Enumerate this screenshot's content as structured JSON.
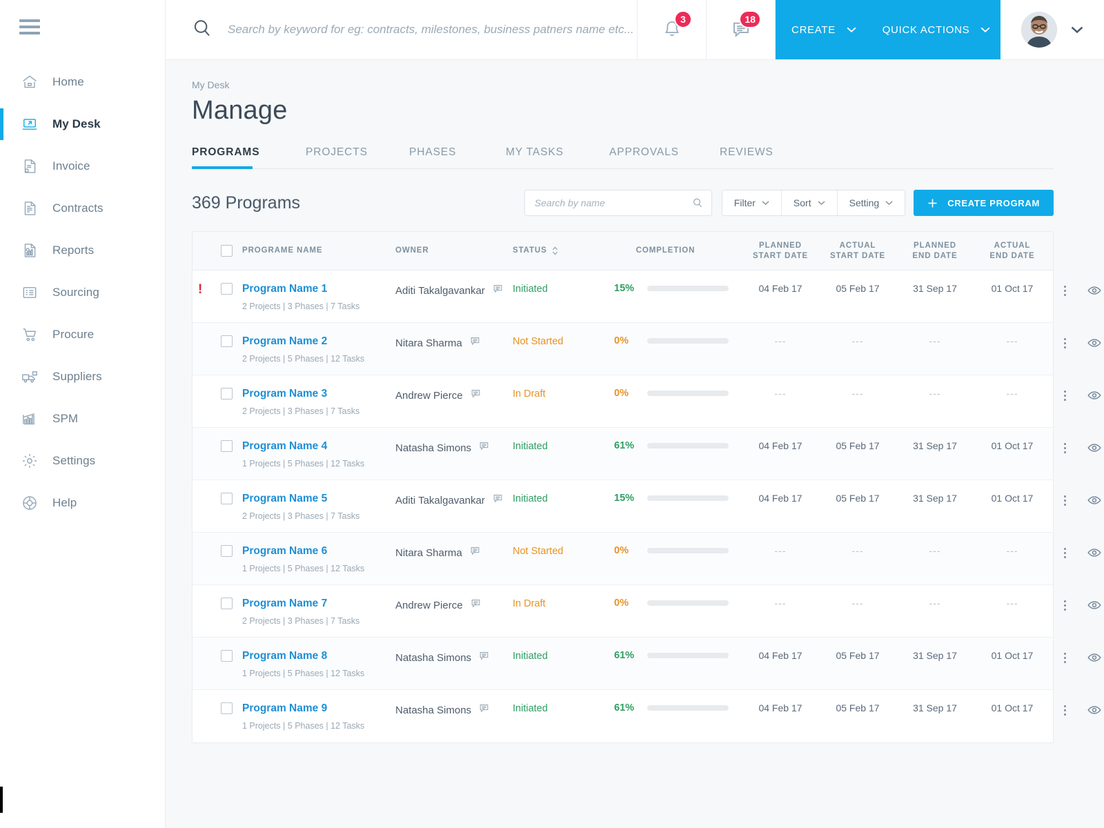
{
  "colors": {
    "accent": "#10aae8",
    "badge": "#ec2b57",
    "green": "#2f9e63",
    "bar_green": "#35a06a",
    "amber": "#e79326",
    "link": "#1e8fd5",
    "alert_red": "#d32b3a"
  },
  "header": {
    "search_placeholder": "Search by keyword for eg: contracts, milestones, business patners name etc...",
    "notifications_count": "3",
    "messages_count": "18",
    "create_label": "CREATE",
    "quick_actions_label": "QUICK ACTIONS"
  },
  "sidebar": {
    "items": [
      {
        "label": "Home",
        "icon": "home-icon",
        "active": false
      },
      {
        "label": "My Desk",
        "icon": "desk-icon",
        "active": true
      },
      {
        "label": "Invoice",
        "icon": "invoice-icon",
        "active": false
      },
      {
        "label": "Contracts",
        "icon": "contracts-icon",
        "active": false
      },
      {
        "label": "Reports",
        "icon": "reports-icon",
        "active": false
      },
      {
        "label": "Sourcing",
        "icon": "sourcing-icon",
        "active": false
      },
      {
        "label": "Procure",
        "icon": "cart-icon",
        "active": false
      },
      {
        "label": "Suppliers",
        "icon": "truck-icon",
        "active": false
      },
      {
        "label": "SPM",
        "icon": "bar-chart-icon",
        "active": false
      },
      {
        "label": "Settings",
        "icon": "gear-icon",
        "active": false
      },
      {
        "label": "Help",
        "icon": "lifebuoy-icon",
        "active": false
      }
    ]
  },
  "page": {
    "breadcrumb": "My Desk",
    "title": "Manage",
    "tabs": [
      {
        "label": "PROGRAMS",
        "active": true
      },
      {
        "label": "PROJECTS",
        "active": false
      },
      {
        "label": "PHASES",
        "active": false
      },
      {
        "label": "MY TASKS",
        "active": false
      },
      {
        "label": "APPROVALS",
        "active": false
      },
      {
        "label": "REVIEWS",
        "active": false
      }
    ]
  },
  "toolbar": {
    "count_label": "369 Programs",
    "search_placeholder": "Search by name",
    "filter_label": "Filter",
    "sort_label": "Sort",
    "setting_label": "Setting",
    "create_program_label": "CREATE PROGRAM"
  },
  "table": {
    "columns": [
      "PROGRAME NAME",
      "OWNER",
      "STATUS",
      "COMPLETION",
      "PLANNED START DATE",
      "ACTUAL START DATE",
      "PLANNED END DATE",
      "ACTUAL END DATE"
    ],
    "columns_split": [
      {
        "l1": "PLANNED",
        "l2": "START DATE"
      },
      {
        "l1": "ACTUAL",
        "l2": "START DATE"
      },
      {
        "l1": "PLANNED",
        "l2": "END DATE"
      },
      {
        "l1": "ACTUAL",
        "l2": "END DATE"
      }
    ],
    "rows": [
      {
        "alert": true,
        "name": "Program Name 1",
        "sub": "2 Projects  |  3 Phases  |  7 Tasks",
        "owner": "Aditi Takalgavankar",
        "status": "Initiated",
        "status_kind": "initiated",
        "completion": "15%",
        "completion_value": 15,
        "planned_start": "04 Feb 17",
        "actual_start": "05 Feb 17",
        "planned_end": "31 Sep 17",
        "actual_end": "01 Oct 17"
      },
      {
        "alert": false,
        "name": "Program Name 2",
        "sub": "2 Projects  | 5 Phases  |  12 Tasks",
        "owner": "Nitara Sharma",
        "status": "Not Started",
        "status_kind": "notstarted",
        "completion": "0%",
        "completion_value": 0,
        "planned_start": "---",
        "actual_start": "---",
        "planned_end": "---",
        "actual_end": "---"
      },
      {
        "alert": false,
        "name": "Program Name 3",
        "sub": "2 Projects  |  3 Phases  |  7 Tasks",
        "owner": "Andrew Pierce",
        "status": "In Draft",
        "status_kind": "draft",
        "completion": "0%",
        "completion_value": 0,
        "planned_start": "---",
        "actual_start": "---",
        "planned_end": "---",
        "actual_end": "---"
      },
      {
        "alert": false,
        "name": "Program Name 4",
        "sub": "1 Projects  | 5 Phases  |  12 Tasks",
        "owner": "Natasha Simons",
        "status": "Initiated",
        "status_kind": "initiated",
        "completion": "61%",
        "completion_value": 61,
        "planned_start": "04 Feb 17",
        "actual_start": "05 Feb 17",
        "planned_end": "31 Sep 17",
        "actual_end": "01 Oct 17"
      },
      {
        "alert": false,
        "name": "Program Name 5",
        "sub": "2 Projects  |  3 Phases  |  7 Tasks",
        "owner": "Aditi Takalgavankar",
        "status": "Initiated",
        "status_kind": "initiated",
        "completion": "15%",
        "completion_value": 15,
        "planned_start": "04 Feb 17",
        "actual_start": "05 Feb 17",
        "planned_end": "31 Sep 17",
        "actual_end": "01 Oct 17"
      },
      {
        "alert": false,
        "name": "Program Name 6",
        "sub": "1 Projects  | 5 Phases  |  12 Tasks",
        "owner": "Nitara Sharma",
        "status": "Not Started",
        "status_kind": "notstarted",
        "completion": "0%",
        "completion_value": 0,
        "planned_start": "---",
        "actual_start": "---",
        "planned_end": "---",
        "actual_end": "---"
      },
      {
        "alert": false,
        "name": "Program Name 7",
        "sub": "2 Projects  |  3 Phases  |  7 Tasks",
        "owner": "Andrew Pierce",
        "status": "In Draft",
        "status_kind": "draft",
        "completion": "0%",
        "completion_value": 0,
        "planned_start": "---",
        "actual_start": "---",
        "planned_end": "---",
        "actual_end": "---"
      },
      {
        "alert": false,
        "name": "Program Name 8",
        "sub": "1 Projects  | 5 Phases  |  12 Tasks",
        "owner": "Natasha Simons",
        "status": "Initiated",
        "status_kind": "initiated",
        "completion": "61%",
        "completion_value": 61,
        "planned_start": "04 Feb 17",
        "actual_start": "05 Feb 17",
        "planned_end": "31 Sep 17",
        "actual_end": "01 Oct 17"
      },
      {
        "alert": false,
        "name": "Program Name 9",
        "sub": "1 Projects  | 5 Phases  |  12 Tasks",
        "owner": "Natasha Simons",
        "status": "Initiated",
        "status_kind": "initiated",
        "completion": "61%",
        "completion_value": 61,
        "planned_start": "04 Feb 17",
        "actual_start": "05 Feb 17",
        "planned_end": "31 Sep 17",
        "actual_end": "01 Oct 17"
      }
    ]
  }
}
